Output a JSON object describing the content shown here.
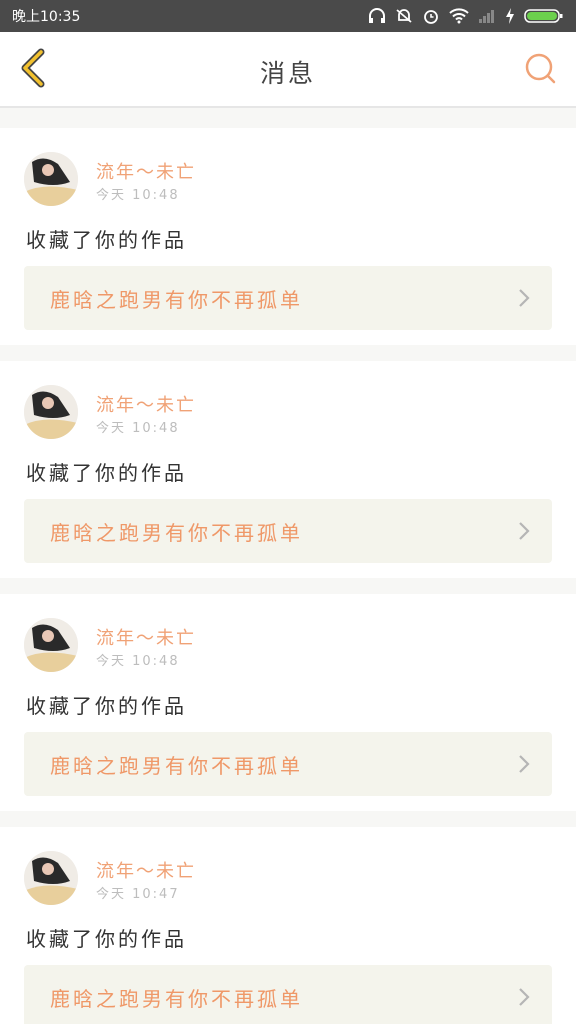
{
  "status": {
    "carrier_time": "晚上10:35"
  },
  "header": {
    "title": "消息"
  },
  "colors": {
    "accent": "#f0a276",
    "back": "#f2c12e",
    "card_bg": "#f4f4ec"
  },
  "messages": [
    {
      "user": "流年～未亡",
      "time": "今天 10:48",
      "action": "收藏了你的作品",
      "work": "鹿晗之跑男有你不再孤单"
    },
    {
      "user": "流年～未亡",
      "time": "今天 10:48",
      "action": "收藏了你的作品",
      "work": "鹿晗之跑男有你不再孤单"
    },
    {
      "user": "流年～未亡",
      "time": "今天 10:48",
      "action": "收藏了你的作品",
      "work": "鹿晗之跑男有你不再孤单"
    },
    {
      "user": "流年～未亡",
      "time": "今天 10:47",
      "action": "收藏了你的作品",
      "work": "鹿晗之跑男有你不再孤单"
    }
  ]
}
